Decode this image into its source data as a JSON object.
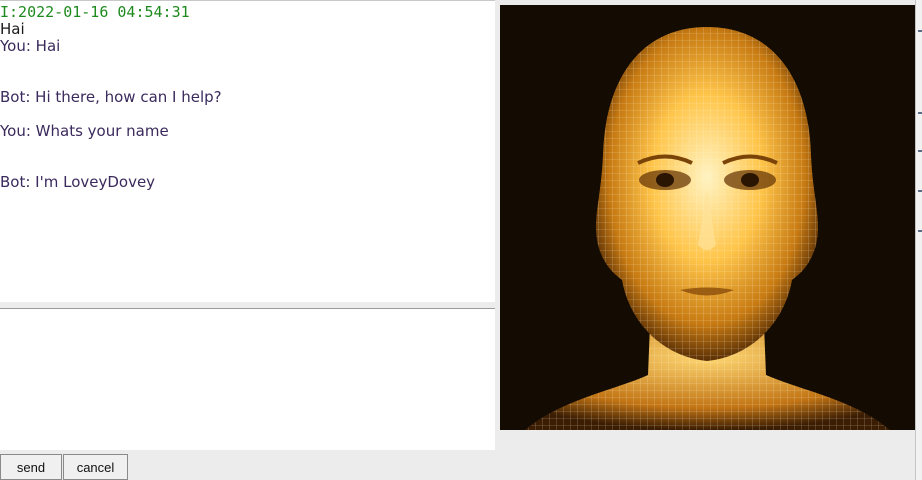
{
  "chat": {
    "timestamp": "I:2022-01-16 04:54:31",
    "messages": [
      {
        "text": "Hai"
      },
      {
        "text": "You: Hai"
      },
      {
        "text": "Bot: Hi there, how can I help?"
      },
      {
        "text": "You: Whats your name"
      },
      {
        "text": "Bot: I'm LoveyDovey"
      }
    ]
  },
  "input": {
    "value": "",
    "placeholder": ""
  },
  "buttons": {
    "send": "send",
    "cancel": "cancel"
  },
  "avatar": {
    "icon": "wireframe-head-icon"
  },
  "colors": {
    "timestamp": "#1e8a1e",
    "message_text": "#3b2a5c",
    "avatar_background": "#140b02",
    "avatar_glow": "#ffc54a"
  }
}
